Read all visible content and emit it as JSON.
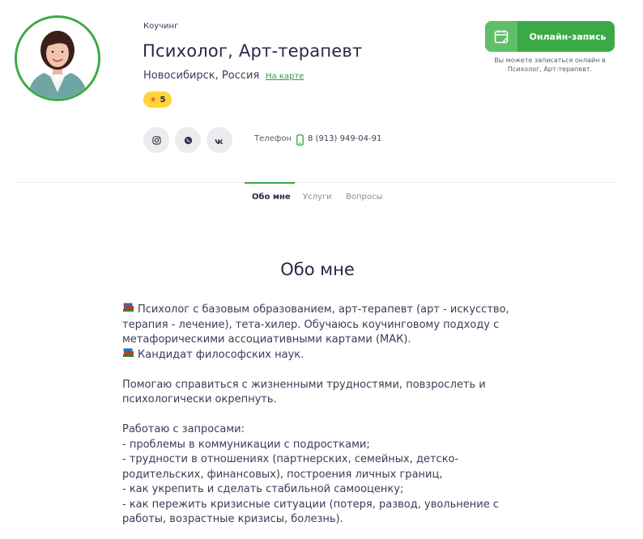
{
  "profile": {
    "category": "Коучинг",
    "title": "Психолог, Арт-терапевт",
    "location": "Новосибирск, Россия",
    "map_link": "На карте",
    "rating": "5",
    "phone_label": "Телефон",
    "phone_number": "8 (913) 949-04-91"
  },
  "social": [
    "instagram-icon",
    "viber-icon",
    "vk-icon"
  ],
  "booking": {
    "button_label": "Онлайн-запись",
    "note": "Вы можете записаться онлайн в Психолог, Арт-терапевт."
  },
  "tabs": [
    {
      "label": "Обо мне",
      "active": true
    },
    {
      "label": "Услуги",
      "active": false
    },
    {
      "label": "Вопросы",
      "active": false
    }
  ],
  "about": {
    "title": "Обо мне",
    "line1": "Психолог с базовым образованием, арт-терапевт (арт - искусство, терапия - лечение), тета-хилер. Обучаюсь коучинговому подходу с метафорическими ассоциативными картами (МАК).",
    "line2": "Кандидат философских наук.",
    "para2": "Помогаю справиться с жизненными трудностями, повзрослеть и психологически окрепнуть.",
    "requests_intro": "Работаю с запросами:",
    "requests": [
      "- проблемы в коммуникации с подростками;",
      "- трудности в отношениях (партнерских, семейных, детско-родительских, финансовых), построения личных границ,",
      "- как укрепить и сделать стабильной самооценку;",
      "- как пережить кризисные ситуации (потеря, развод, увольнение с работы, возрастные кризисы, болезнь)."
    ]
  },
  "colors": {
    "accent_green": "#3aaa46",
    "rating_yellow": "#ffd43b",
    "text_dark": "#262845"
  }
}
